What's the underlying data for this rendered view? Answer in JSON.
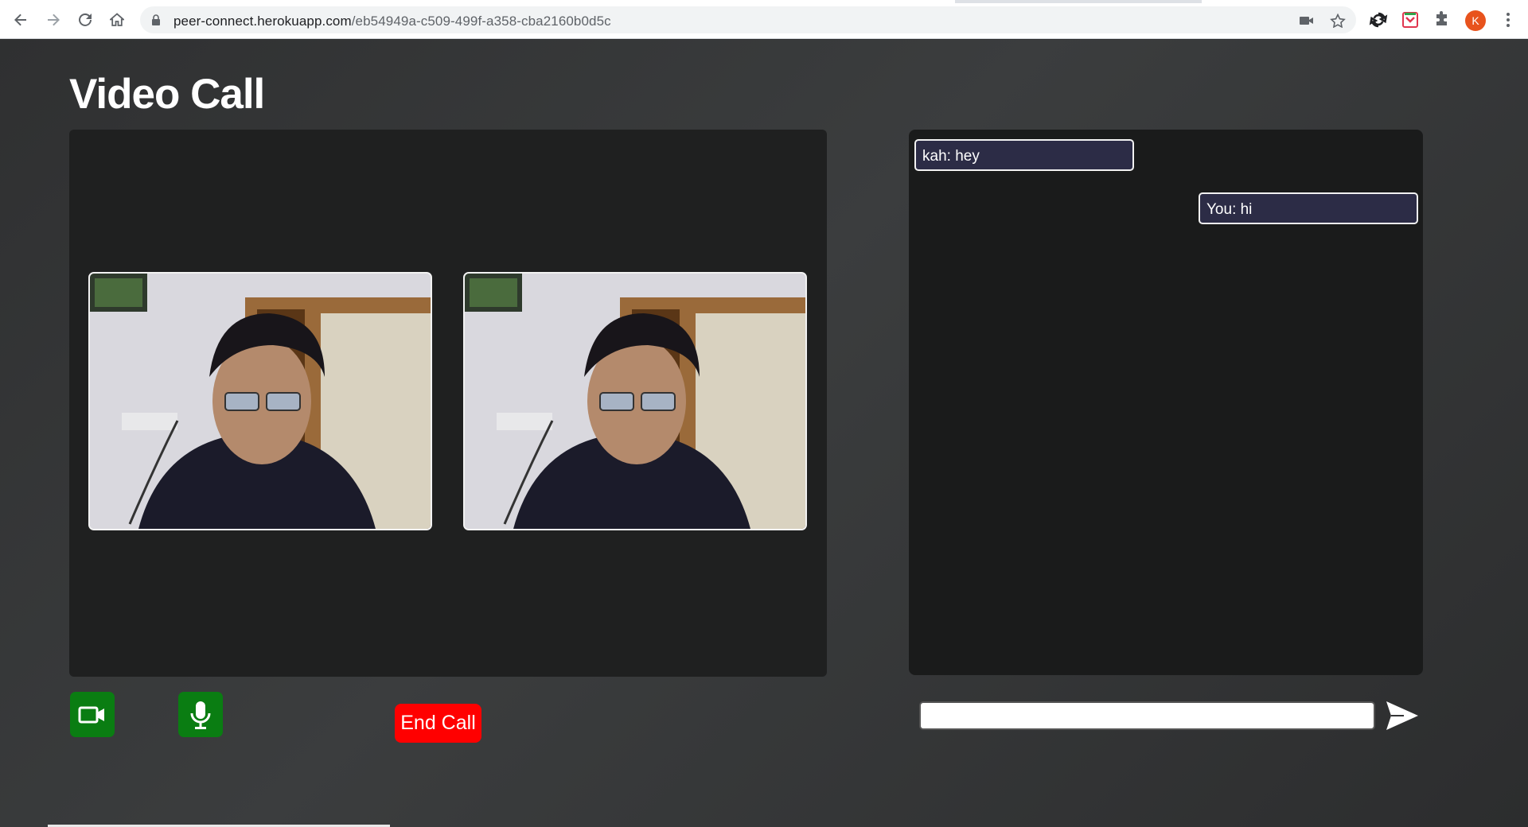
{
  "browser": {
    "url_host": "peer-connect.herokuapp.com",
    "url_path": "/eb54949a-c509-499f-a358-cba2160b0d5c",
    "profile_initial": "K",
    "icons": [
      "back-arrow-icon",
      "forward-arrow-icon",
      "reload-icon",
      "home-icon",
      "lock-icon",
      "camera-icon",
      "star-icon",
      "sync-icon",
      "pocket-icon",
      "puzzle-icon",
      "kebab-menu-icon"
    ]
  },
  "page": {
    "title": "Video Call"
  },
  "videos": [
    {
      "label": "local-video"
    },
    {
      "label": "remote-video"
    }
  ],
  "controls": {
    "end_call_label": "End Call",
    "camera_color": "#0a7d12",
    "mic_color": "#0a7d12",
    "end_call_color": "#ff0000"
  },
  "chat": {
    "messages": [
      {
        "text": "kah: hey",
        "side": "left"
      },
      {
        "text": "You: hi",
        "side": "right"
      }
    ],
    "input_value": "",
    "input_placeholder": ""
  }
}
